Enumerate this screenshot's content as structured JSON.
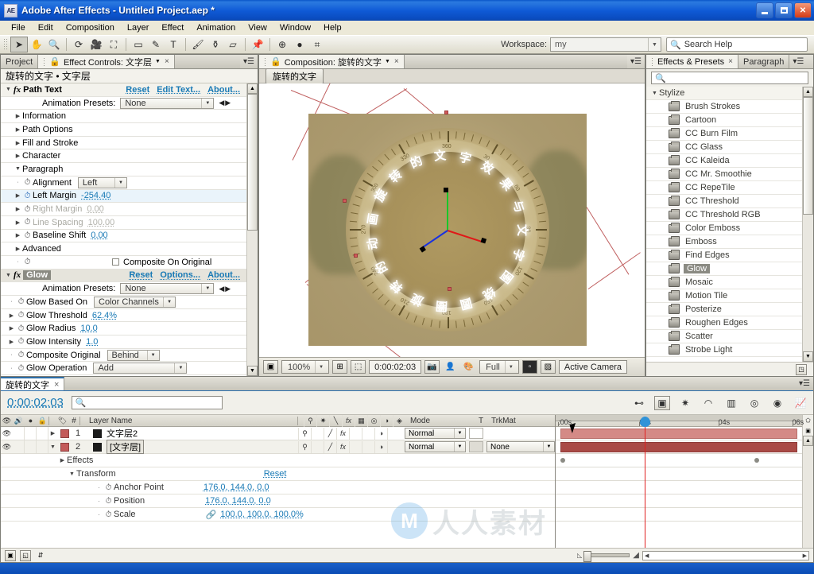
{
  "window": {
    "title": "Adobe After Effects - Untitled Project.aep *",
    "logo": "AE",
    "minimize": "_",
    "maximize": "□",
    "close": "✕"
  },
  "menubar": [
    "File",
    "Edit",
    "Composition",
    "Layer",
    "Effect",
    "Animation",
    "View",
    "Window",
    "Help"
  ],
  "toolbar": {
    "tools": [
      "selection-tool",
      "hand-tool",
      "zoom-tool",
      "rotation-tool",
      "camera-tool",
      "pan-behind-tool",
      "shape-tool",
      "pen-tool",
      "text-tool",
      "brush-tool",
      "clone-stamp-tool",
      "eraser-tool",
      "puppet-pin-tool"
    ],
    "workspace_label": "Workspace:",
    "workspace_value": "my",
    "search_help_placeholder": "Search Help"
  },
  "effect_controls": {
    "tab_project": "Project",
    "tab_title": "Effect Controls: 文字层",
    "header": "旋转的文字 • 文字层",
    "effects": [
      {
        "name": "Path Text",
        "links": [
          "Reset",
          "Edit Text...",
          "About..."
        ],
        "preset_label": "Animation Presets:",
        "preset_value": "None",
        "groups": [
          "Information",
          "Path Options",
          "Fill and Stroke",
          "Character",
          "Paragraph"
        ],
        "params": [
          {
            "name": "Alignment",
            "value": "Left",
            "type": "dropdown",
            "dim": false
          },
          {
            "name": "Left Margin",
            "value": "-254.40",
            "type": "value",
            "dim": false,
            "selected": true
          },
          {
            "name": "Right Margin",
            "value": "0.00",
            "type": "value",
            "dim": true
          },
          {
            "name": "Line Spacing",
            "value": "100.00",
            "type": "value",
            "dim": true
          },
          {
            "name": "Baseline Shift",
            "value": "0.00",
            "type": "value",
            "dim": false
          }
        ],
        "advanced": "Advanced",
        "composite_on_original": "Composite On Original"
      },
      {
        "name": "Glow",
        "links": [
          "Reset",
          "Options...",
          "About..."
        ],
        "preset_label": "Animation Presets:",
        "preset_value": "None",
        "params": [
          {
            "name": "Glow Based On",
            "value": "Color Channels",
            "type": "dropdown"
          },
          {
            "name": "Glow Threshold",
            "value": "62.4%",
            "type": "value"
          },
          {
            "name": "Glow Radius",
            "value": "10.0",
            "type": "value"
          },
          {
            "name": "Glow Intensity",
            "value": "1.0",
            "type": "value"
          },
          {
            "name": "Composite Original",
            "value": "Behind",
            "type": "dropdown"
          },
          {
            "name": "Glow Operation",
            "value": "Add",
            "type": "dropdown"
          }
        ]
      }
    ]
  },
  "composition": {
    "tab_title": "Composition: 旋转的文字",
    "chip": "旋转的文字",
    "footer": {
      "zoom": "100%",
      "timecode": "0:00:02:03",
      "resolution": "Full",
      "view": "Active Camera"
    },
    "artwork": {
      "description": "compass-over-photo",
      "degree_labels": [
        "360",
        "30",
        "60",
        "90",
        "120",
        "150",
        "180",
        "210",
        "240",
        "270",
        "300",
        "330"
      ],
      "circular_text": "旋转的文字效果与文字围绕圆圈旋转的动画"
    }
  },
  "effects_presets": {
    "tab_title": "Effects & Presets",
    "tab_secondary": "Paragraph",
    "search_placeholder": "",
    "group": "Stylize",
    "items": [
      {
        "label": "Brush Strokes",
        "bits": "8"
      },
      {
        "label": "Cartoon",
        "bits": "32"
      },
      {
        "label": "CC Burn Film",
        "bits": "8"
      },
      {
        "label": "CC Glass",
        "bits": "8"
      },
      {
        "label": "CC Kaleida",
        "bits": "8"
      },
      {
        "label": "CC Mr. Smoothie",
        "bits": "8"
      },
      {
        "label": "CC RepeTile",
        "bits": "8"
      },
      {
        "label": "CC Threshold",
        "bits": "32"
      },
      {
        "label": "CC Threshold RGB",
        "bits": "32"
      },
      {
        "label": "Color Emboss",
        "bits": "16"
      },
      {
        "label": "Emboss",
        "bits": "16"
      },
      {
        "label": "Find Edges",
        "bits": "8"
      },
      {
        "label": "Glow",
        "bits": "32",
        "selected": true
      },
      {
        "label": "Mosaic",
        "bits": "16"
      },
      {
        "label": "Motion Tile",
        "bits": "8"
      },
      {
        "label": "Posterize",
        "bits": "32"
      },
      {
        "label": "Roughen Edges",
        "bits": "8"
      },
      {
        "label": "Scatter",
        "bits": "16"
      },
      {
        "label": "Strobe Light",
        "bits": "8"
      }
    ]
  },
  "timeline": {
    "tab_title": "旋转的文字",
    "current_time": "0:00:02:03",
    "search_placeholder": "",
    "columns": {
      "layer_name": "Layer Name",
      "hash": "#",
      "mode": "Mode",
      "t": "T",
      "trkmat": "TrkMat"
    },
    "layers": [
      {
        "index": "1",
        "name": "文字层2",
        "mode": "Normal",
        "trkmat": "",
        "boxed": false
      },
      {
        "index": "2",
        "name": "[文字层]",
        "mode": "Normal",
        "trkmat": "None",
        "boxed": true
      }
    ],
    "properties": [
      {
        "indent": 1,
        "name": "Effects",
        "value": "",
        "triangle": "▶"
      },
      {
        "indent": 1,
        "name": "Transform",
        "value": "Reset",
        "triangle": "▼"
      },
      {
        "indent": 2,
        "name": "Anchor Point",
        "value": "176.0, 144.0, 0.0",
        "stopwatch": true
      },
      {
        "indent": 2,
        "name": "Position",
        "value": "176.0, 144.0, 0.0",
        "stopwatch": true
      },
      {
        "indent": 2,
        "name": "Scale",
        "value": "100.0, 100.0, 100.0%",
        "stopwatch": true,
        "link": true
      }
    ],
    "ruler_ticks": [
      {
        "label": ":00s",
        "pct": 1
      },
      {
        "label": "02s",
        "pct": 34
      },
      {
        "label": "04s",
        "pct": 66
      },
      {
        "label": "06s",
        "pct": 96
      }
    ],
    "playhead_pct": 36
  },
  "colors": {
    "accent_blue": "#1879b5",
    "title_blue": "#0f5ad6",
    "layer_bar_1": "#d48a86",
    "layer_bar_2": "#a94a46",
    "playhead_red": "#e12020",
    "label_swatch": "#c35a5a"
  },
  "watermark": {
    "mark": "M",
    "text": "人人素材"
  }
}
